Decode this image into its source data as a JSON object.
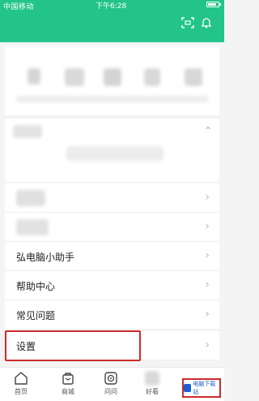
{
  "status_bar": {
    "carrier": "中国移动",
    "time": "下午6:28"
  },
  "profile_card": {
    "items": [
      "",
      "",
      "",
      "",
      ""
    ]
  },
  "menu": {
    "items": [
      {
        "label": ""
      },
      {
        "label": "弘电脑小助手"
      },
      {
        "label": "帮助中心"
      },
      {
        "label": "常见问题"
      },
      {
        "label": "设置"
      }
    ]
  },
  "bottom_nav": {
    "tabs": [
      {
        "label": "首页",
        "icon": "home-icon"
      },
      {
        "label": "商城",
        "icon": "shop-bag-icon"
      },
      {
        "label": "问问",
        "icon": "ask-icon"
      },
      {
        "label": "好看",
        "icon": "watch-icon"
      }
    ]
  },
  "watermark": {
    "text": "电脑下载站"
  },
  "colors": {
    "header": "#22c48a",
    "highlight": "#cc2b2b"
  }
}
